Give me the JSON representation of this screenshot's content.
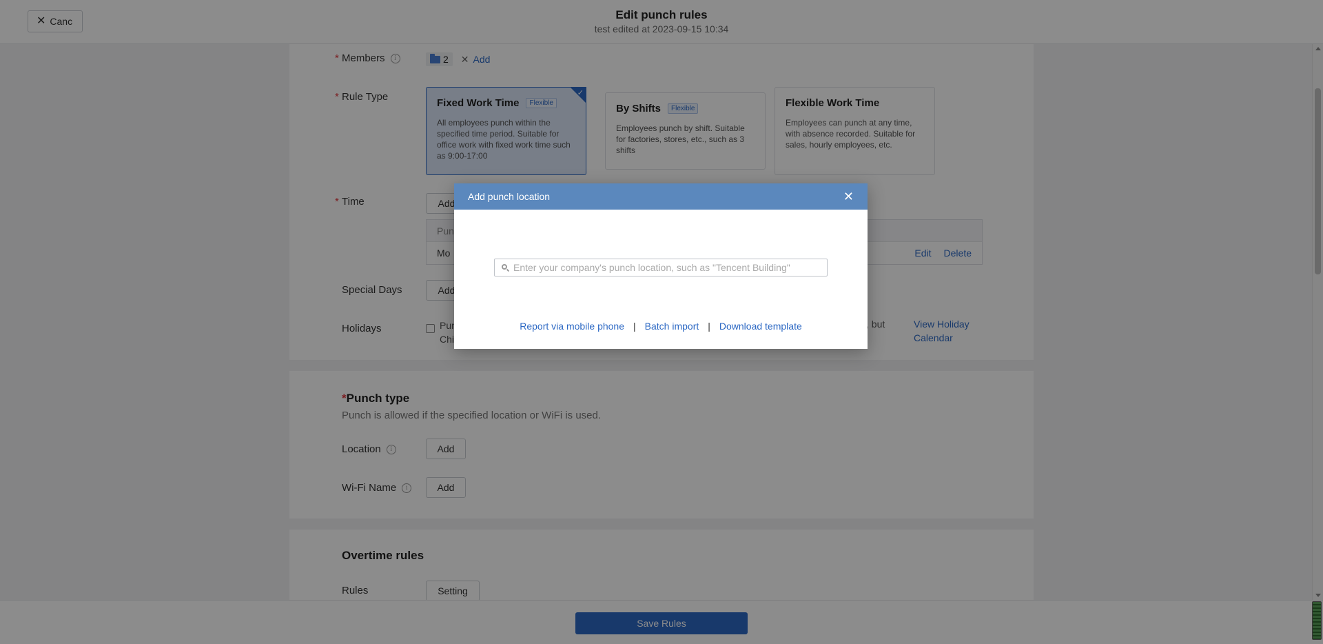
{
  "header": {
    "cancel_label": "Canc",
    "title": "Edit punch rules",
    "subtitle": "test edited at 2023-09-15 10:34"
  },
  "rules_section": {
    "members": {
      "label": "Members",
      "count": "2",
      "add_label": "Add"
    },
    "rule_type": {
      "label": "Rule Type",
      "options": [
        {
          "title": "Fixed Work Time",
          "badge": "Flexible",
          "desc": "All employees punch within the specified time period. Suitable for office work with fixed work time such as 9:00-17:00",
          "selected": true
        },
        {
          "title": "By Shifts",
          "badge": "Flexible",
          "desc": "Employees punch by shift. Suitable for factories, stores, etc., such as 3 shifts",
          "selected": false
        },
        {
          "title": "Flexible Work Time",
          "badge": "",
          "desc": "Employees can punch at any time, with absence recorded. Suitable for sales, hourly employees, etc.",
          "selected": false
        }
      ]
    },
    "time": {
      "label": "Time",
      "add_label": "Add",
      "header_text": "Pun",
      "row_text": "Mo",
      "edit_label": "Edit",
      "delete_label": "Delete"
    },
    "special_days": {
      "label": "Special Days",
      "add_label": "Add"
    },
    "holidays": {
      "label": "Holidays",
      "text_line1": "Pun",
      "text_line2": "Chi",
      "text_right": "s, but",
      "link_line1": "View Holiday",
      "link_line2": "Calendar"
    }
  },
  "punch_type": {
    "title": "Punch type",
    "subtitle": "Punch is allowed if the specified location or WiFi is used.",
    "location_label": "Location",
    "location_add": "Add",
    "wifi_label": "Wi-Fi Name",
    "wifi_add": "Add"
  },
  "overtime": {
    "title": "Overtime rules",
    "rules_label": "Rules",
    "setting_label": "Setting"
  },
  "footer": {
    "save_label": "Save Rules"
  },
  "modal": {
    "title": "Add punch location",
    "search_placeholder": "Enter your company's punch location, such as \"Tencent Building\"",
    "links": [
      "Report via mobile phone",
      "Batch import",
      "Download template"
    ],
    "separator": "|"
  },
  "colors": {
    "accent": "#2d69c4",
    "modal_header": "#5b88bd",
    "required": "#e0383e"
  }
}
